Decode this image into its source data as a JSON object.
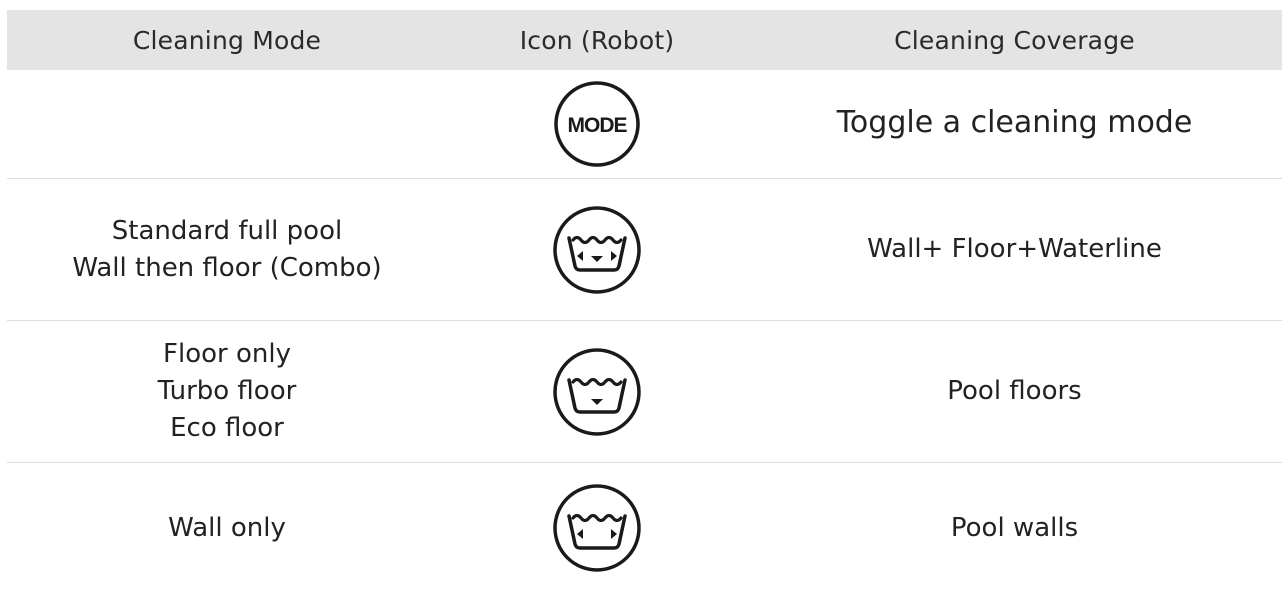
{
  "headers": {
    "mode": "Cleaning Mode",
    "icon": "Icon (Robot)",
    "coverage": "Cleaning Coverage"
  },
  "rows": [
    {
      "mode_lines": [],
      "icon": "mode-button-icon",
      "icon_text": "MODE",
      "coverage": "Toggle a cleaning mode"
    },
    {
      "mode_lines": [
        "Standard full pool",
        "Wall then floor (Combo)"
      ],
      "icon": "pool-wall-floor-waterline-icon",
      "coverage": "Wall+ Floor+Waterline"
    },
    {
      "mode_lines": [
        "Floor only",
        "Turbo floor",
        "Eco floor"
      ],
      "icon": "pool-floor-icon",
      "coverage": "Pool floors"
    },
    {
      "mode_lines": [
        "Wall only"
      ],
      "icon": "pool-wall-icon",
      "coverage": "Pool walls"
    }
  ]
}
